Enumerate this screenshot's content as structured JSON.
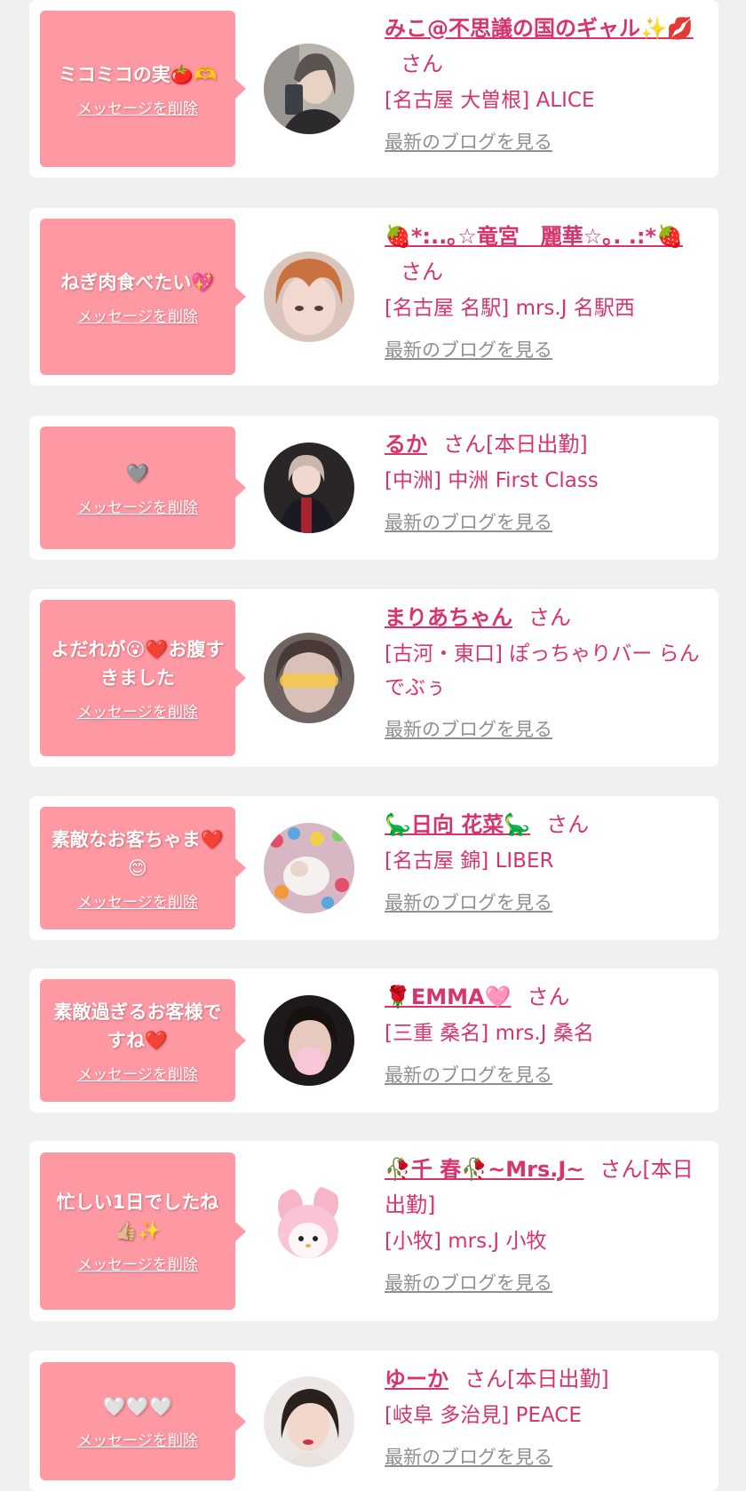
{
  "items": [
    {
      "message": "ミコミコの実🍅🫶",
      "delete_label": "メッセージを削除",
      "name": "みこ@不思議の国のギャル✨💋",
      "suffix": "さん",
      "shop": "[名古屋 大曽根] ALICE",
      "blog_link": "最新のブログを見る",
      "avatar": "woman-selfie-photo"
    },
    {
      "message": "ねぎ肉食べたい💖",
      "delete_label": "メッセージを削除",
      "name": "🍓*:..｡☆竜宮　麗華☆｡. .:*🍓",
      "suffix": "さん",
      "shop": "[名古屋 名駅] mrs.J 名駅西",
      "blog_link": "最新のブログを見る",
      "avatar": "woman-bangs-photo"
    },
    {
      "message": "🩶",
      "delete_label": "メッセージを削除",
      "name": "るか",
      "suffix": "さん[本日出勤]",
      "shop": "[中洲] 中洲 First Class",
      "blog_link": "最新のブログを見る",
      "avatar": "woman-dark-photo"
    },
    {
      "message": "よだれが😮❤️お腹すきました",
      "delete_label": "メッセージを削除",
      "name": "まりあちゃん",
      "suffix": "さん",
      "shop": "[古河・東口] ぽっちゃりバー らんでぶぅ",
      "blog_link": "最新のブログを見る",
      "avatar": "happy-sticker-photo"
    },
    {
      "message": "素敵なお客ちゃま❤️😊",
      "delete_label": "メッセージを削除",
      "name": "🦕日向 花菜🦕",
      "suffix": "さん",
      "shop": "[名古屋 錦] LIBER",
      "blog_link": "最新のブログを見る",
      "avatar": "ball-pit-photo"
    },
    {
      "message": "素敵過ぎるお客様ですね❤️",
      "delete_label": "メッセージを削除",
      "name": "🌹EMMA🩷",
      "suffix": "さん",
      "shop": "[三重 桑名] mrs.J 桑名",
      "blog_link": "最新のブログを見る",
      "avatar": "emma-photo"
    },
    {
      "message": "忙しい1日でしたね👍🏼✨",
      "delete_label": "メッセージを削除",
      "name": "🥀千 春🥀~Mrs.J~",
      "suffix": "さん[本日出勤]",
      "shop": "[小牧] mrs.J 小牧",
      "blog_link": "最新のブログを見る",
      "avatar": "plush-toy-photo"
    },
    {
      "message": "🤍🤍🤍",
      "delete_label": "メッセージを削除",
      "name": "ゆーか",
      "suffix": "さん[本日出勤]",
      "shop": "[岐阜 多治見] PEACE",
      "blog_link": "最新のブログを見る",
      "avatar": "woman-portrait-photo"
    }
  ],
  "colors": {
    "bubble": "#fe99a4",
    "accent": "#d8346b",
    "link_gray": "#8f8f8f",
    "background": "#f1f0f1"
  }
}
